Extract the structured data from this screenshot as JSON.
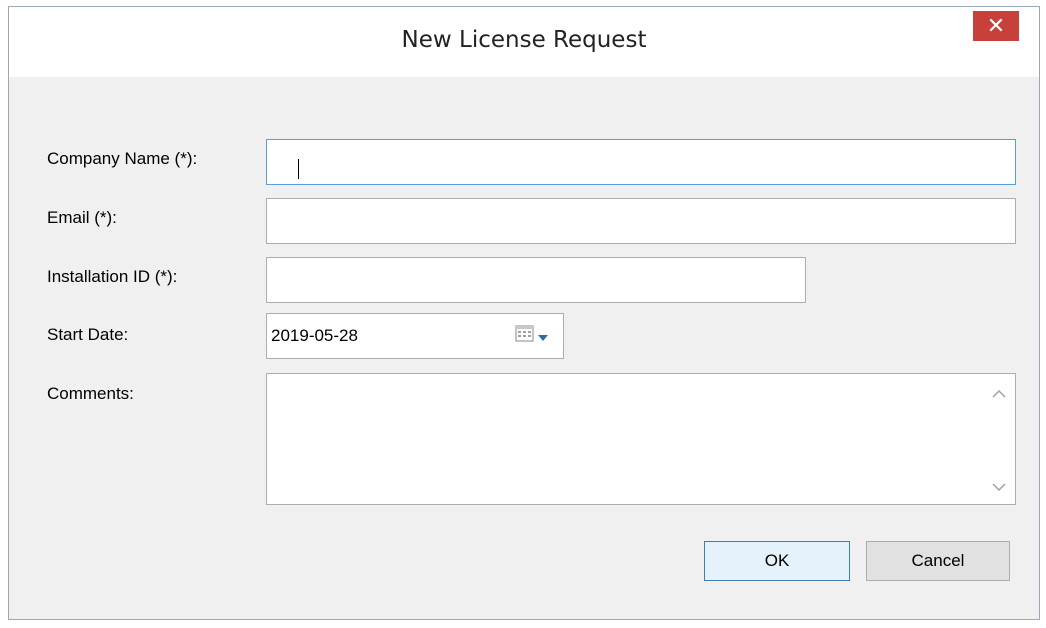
{
  "window": {
    "title": "New License Request",
    "close_glyph": "✕"
  },
  "form": {
    "company_label": "Company Name (*):",
    "company_value": "",
    "email_label": "Email (*):",
    "email_value": "",
    "installation_label": "Installation ID (*):",
    "installation_value": "",
    "start_date_label": "Start Date:",
    "start_date_value": "2019-05-28",
    "comments_label": "Comments:",
    "comments_value": ""
  },
  "buttons": {
    "ok_label": "OK",
    "cancel_label": "Cancel"
  },
  "icons": {
    "close": "close-icon",
    "calendar": "calendar-icon",
    "dropdown": "chevron-down-icon",
    "scroll_up": "chevron-up-icon",
    "scroll_down": "chevron-down-icon"
  },
  "colors": {
    "close_button": "#c7403a",
    "focus_border": "#569de5",
    "default_button_border": "#3c7fb1"
  }
}
